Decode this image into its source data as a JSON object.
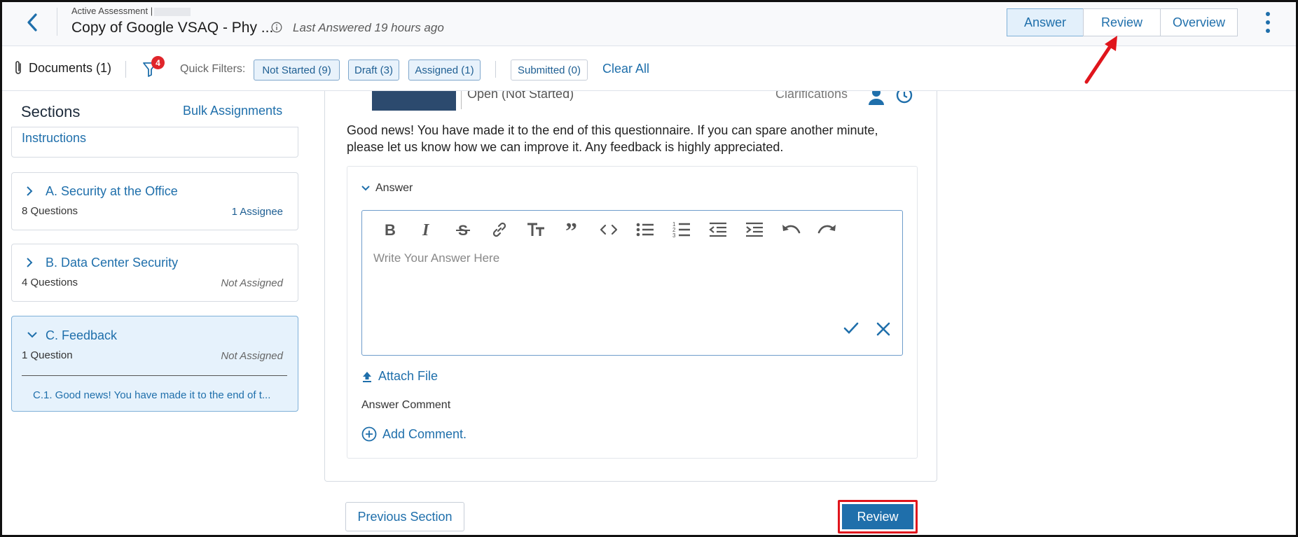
{
  "header": {
    "eyebrow": "Active Assessment |",
    "title": "Copy of Google VSAQ - Phy ...",
    "last_answered": "Last Answered 19 hours ago",
    "tabs": [
      {
        "label": "Answer",
        "active": true
      },
      {
        "label": "Review",
        "active": false
      },
      {
        "label": "Overview",
        "active": false
      }
    ]
  },
  "filterbar": {
    "documents": "Documents (1)",
    "filter_badge": "4",
    "quick_filters_label": "Quick Filters:",
    "chips": [
      "Not Started (9)",
      "Draft (3)",
      "Assigned (1)",
      "Submitted (0)"
    ],
    "clear_all": "Clear All"
  },
  "sidebar": {
    "title": "Sections",
    "bulk": "Bulk Assignments",
    "instructions": "Instructions",
    "sections": [
      {
        "name": "A. Security at the Office",
        "count": "8 Questions",
        "assignee": "1 Assignee"
      },
      {
        "name": "B. Data Center Security",
        "count": "4 Questions",
        "assignee": "Not Assigned"
      },
      {
        "name": "C. Feedback",
        "count": "1 Question",
        "assignee": "Not Assigned",
        "sub_question": "C.1. Good news! You have made it to the end of t..."
      }
    ]
  },
  "main": {
    "status": "Open (Not Started)",
    "clarifications": "Clarifications",
    "question": "Good news! You have made it to the end of this questionnaire. If you can spare another minute, please let us know how we can improve it. Any feedback is highly appreciated.",
    "answer_label": "Answer",
    "editor_placeholder": "Write Your Answer Here",
    "attach_file": "Attach File",
    "answer_comment": "Answer Comment",
    "add_comment": "Add Comment.",
    "toolbar_icons": [
      "bold-icon",
      "italic-icon",
      "strikethrough-icon",
      "link-icon",
      "text-size-icon",
      "blockquote-icon",
      "code-icon",
      "bullet-list-icon",
      "numbered-list-icon",
      "outdent-icon",
      "indent-icon",
      "undo-icon",
      "redo-icon"
    ]
  },
  "footer": {
    "previous": "Previous Section",
    "review": "Review"
  },
  "colors": {
    "accent": "#1f6fab",
    "badge": "#e0252b",
    "highlight": "#e0151c"
  }
}
